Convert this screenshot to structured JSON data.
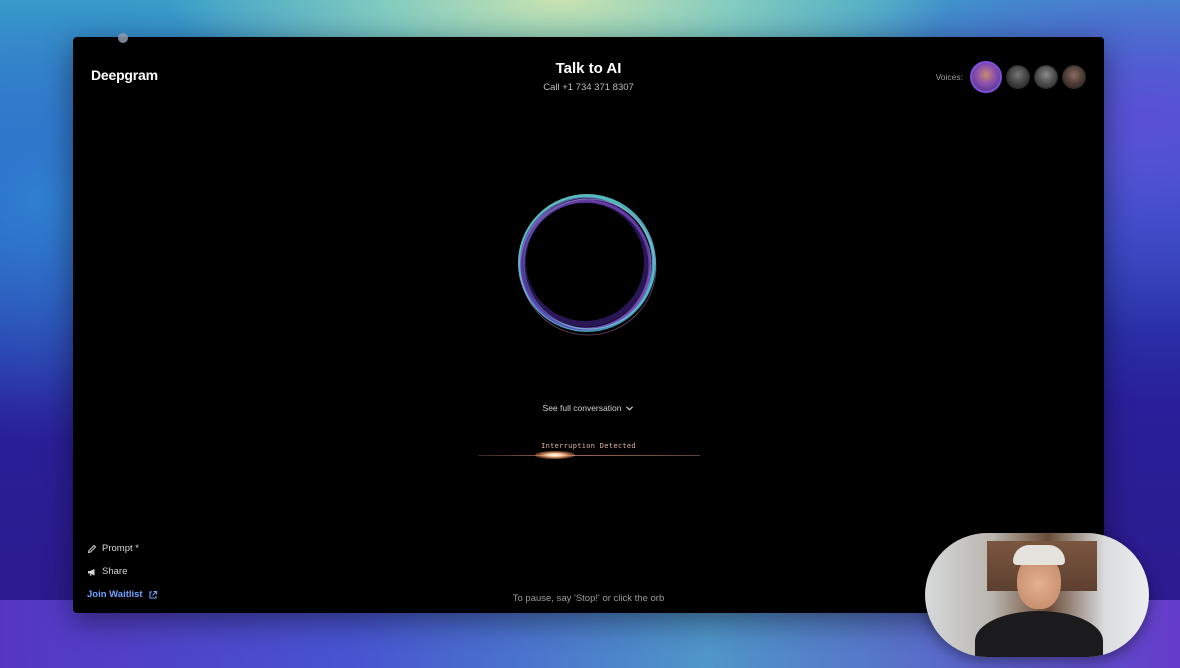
{
  "app": {
    "logo_text": "Deepgram",
    "title": "Talk to AI",
    "subtitle": "Call +1 734 371 8307"
  },
  "voices": {
    "label": "Voices:",
    "avatars": [
      {
        "name": "voice-1",
        "selected": true
      },
      {
        "name": "voice-2",
        "selected": false
      },
      {
        "name": "voice-3",
        "selected": false
      },
      {
        "name": "voice-4",
        "selected": false
      }
    ]
  },
  "conversation": {
    "toggle_label": "See full conversation",
    "toggle_icon": "chevron-down-icon"
  },
  "status": {
    "interruption_text": "Interruption Detected"
  },
  "menu": {
    "prompt_label": "Prompt *",
    "prompt_icon": "pencil-icon",
    "share_label": "Share",
    "share_icon": "megaphone-icon",
    "waitlist_label": "Join Waitlist",
    "waitlist_icon": "external-link-icon"
  },
  "hint": "To pause, say 'Stop!' or click the orb",
  "colors": {
    "accent_link": "#6fa3ff",
    "selected_voice_border": "#7f4fd8",
    "orb_teal": "#53d8c8",
    "orb_purple": "#8a4fe0"
  }
}
